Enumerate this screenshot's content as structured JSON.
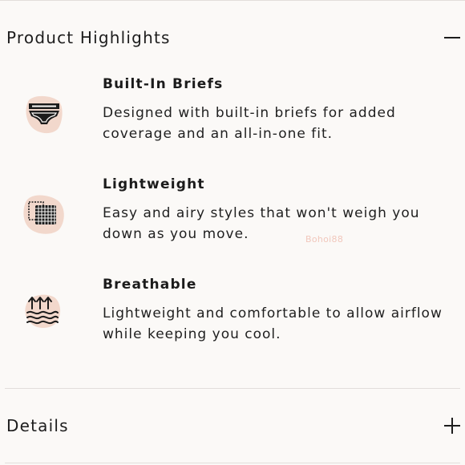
{
  "highlights": {
    "title": "Product Highlights",
    "expanded": true,
    "toggle_icon": "minus-icon",
    "features": [
      {
        "icon": "briefs-icon",
        "title": "Built-In Briefs",
        "description": "Designed with built-in briefs for added coverage and an all-in-one fit."
      },
      {
        "icon": "fabric-mesh-icon",
        "title": "Lightweight",
        "description": "Easy and airy styles that won't weigh you down as you move."
      },
      {
        "icon": "airflow-icon",
        "title": "Breathable",
        "description": "Lightweight and comfortable to allow airflow while keeping you cool."
      }
    ]
  },
  "details": {
    "title": "Details",
    "expanded": false,
    "toggle_icon": "plus-icon"
  },
  "watermark": "Bohoi88",
  "colors": {
    "background": "#fbf9f7",
    "icon_blob": "#f2d8cc",
    "text": "#1b1b1b",
    "divider": "#e2dedb"
  }
}
